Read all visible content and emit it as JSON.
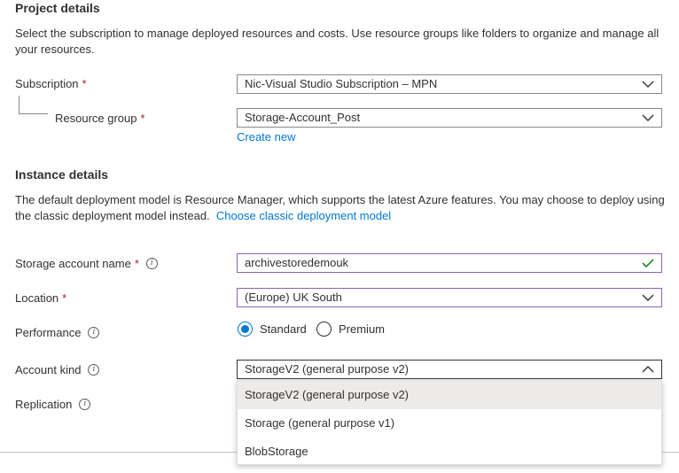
{
  "project": {
    "heading": "Project details",
    "description_line1": "Select the subscription to manage deployed resources and costs. Use resource groups like folders to organize and manage all",
    "description_line2": "your resources.",
    "subscription_label": "Subscription",
    "subscription_value": "Nic-Visual Studio Subscription – MPN",
    "resource_group_label": "Resource group",
    "resource_group_value": "Storage-Account_Post",
    "create_new": "Create new"
  },
  "instance": {
    "heading": "Instance details",
    "description_line1": "The default deployment model is Resource Manager, which supports the latest Azure features. You may choose to deploy using",
    "description_line2": "the classic deployment model instead.",
    "classic_link": "Choose classic deployment model",
    "name_label": "Storage account name",
    "name_value": "archivestoredemouk",
    "location_label": "Location",
    "location_value": "(Europe) UK South",
    "performance_label": "Performance",
    "performance_options": [
      "Standard",
      "Premium"
    ],
    "performance_selected": "Standard",
    "account_kind_label": "Account kind",
    "account_kind_value": "StorageV2 (general purpose v2)",
    "account_kind_options": [
      "StorageV2 (general purpose v2)",
      "Storage (general purpose v1)",
      "BlobStorage"
    ],
    "replication_label": "Replication"
  },
  "required_marker": "*",
  "colors": {
    "link": "#0078d4",
    "required": "#a4262c",
    "valid": "#107c10",
    "focus_border": "#8764b8"
  }
}
